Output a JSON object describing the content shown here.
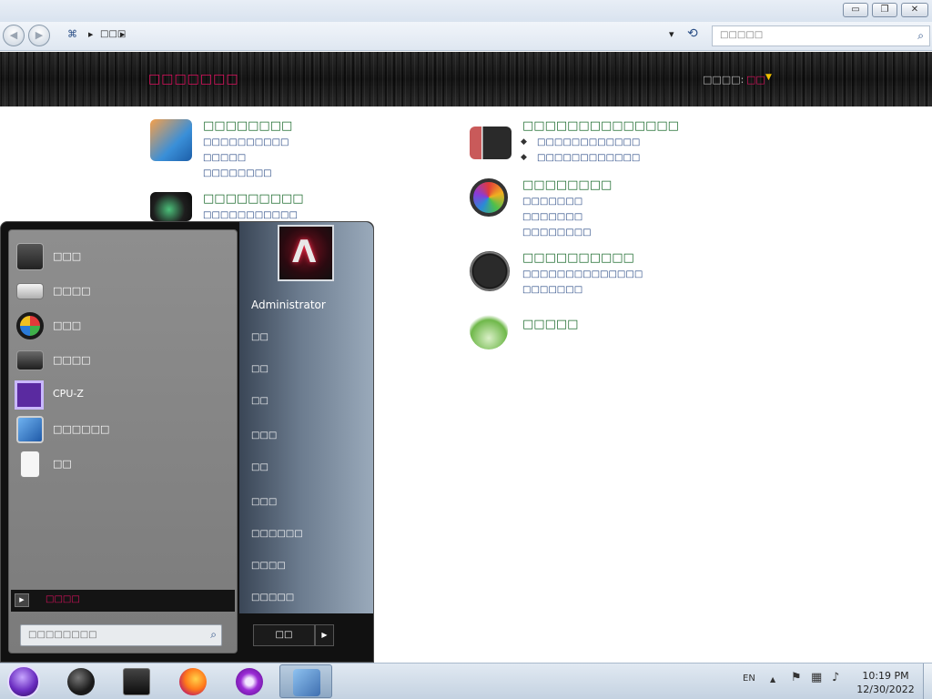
{
  "window": {
    "minimize_glyph": "▭",
    "maximize_glyph": "❐",
    "close_glyph": "✕"
  },
  "addressbar": {
    "back_glyph": "◀",
    "forward_glyph": "▶",
    "crumb_sep": "▶",
    "crumb_label": "□□□",
    "dropdown_glyph": "▾",
    "refresh_glyph": "⟲",
    "search_placeholder": "□□□□□",
    "search_icon": "search-icon"
  },
  "banner": {
    "title": "□□□□□□□",
    "view_by_label": "□□□□:",
    "view_by_value": "□□",
    "caret": "▼"
  },
  "categories": [
    {
      "title": "□□□□□□□□",
      "links": [
        "□□□□□□□□□□",
        "□□□□□",
        "□□□□□□□□"
      ]
    },
    {
      "title": "□□□□□□□□□",
      "links": [
        "□□□□□□□□□□□"
      ]
    },
    {
      "title": "□□□□□□□□□□□□□□",
      "links": [
        "□□□□□□□□□□□□",
        "□□□□□□□□□□□□"
      ]
    },
    {
      "title": "□□□□□□□□",
      "links": [
        "□□□□□□□",
        "□□□□□□□",
        "□□□□□□□□"
      ]
    },
    {
      "title": "□□□□□□□□□□",
      "links": [
        "□□□□□□□□□□□□□□",
        "□□□□□□□"
      ]
    },
    {
      "title": "□□□□□",
      "links": []
    }
  ],
  "start_menu": {
    "programs": [
      {
        "label": "□□□",
        "icon": "calculator-icon",
        "color": "#3a3a3a"
      },
      {
        "label": "□□□□",
        "icon": "keyboard-icon",
        "color": "#c9c9c9"
      },
      {
        "label": "□□□",
        "icon": "windows-logo-icon",
        "color": "#1e1e1e"
      },
      {
        "label": "□□□□",
        "icon": "camcorder-icon",
        "color": "#2d2d2d"
      },
      {
        "label": "CPU-Z",
        "icon": "cpu-z-icon",
        "color": "#5a2aa0"
      },
      {
        "label": "□□□□□□",
        "icon": "remote-desktop-icon",
        "color": "#3b7fd1"
      },
      {
        "label": "□□",
        "icon": "solitaire-icon",
        "color": "#e8e8e8"
      }
    ],
    "all_programs_label": "□□□□",
    "all_programs_arrow": "▶",
    "search_placeholder": "□□□□□□□□",
    "user_name": "Administrator",
    "right_items": [
      "□□",
      "□□",
      "□□",
      "□□□",
      "□□",
      "□□□",
      "□□□□□□",
      "□□□□",
      "□□□□□"
    ],
    "shutdown_label": "□□",
    "shutdown_arrow": "▶"
  },
  "taskbar": {
    "apps": [
      {
        "name": "media-player-icon",
        "color": "#1a1a1a"
      },
      {
        "name": "computer-icon",
        "color": "#111111"
      },
      {
        "name": "firefox-icon",
        "color": "#ff7a1a"
      },
      {
        "name": "infinity-app-icon",
        "color": "#9b2bd6"
      },
      {
        "name": "control-panel-icon",
        "color": "#3f6fb0"
      }
    ],
    "language": "EN",
    "tray_expand": "▲",
    "time": "10:19 PM",
    "date": "12/30/2022"
  }
}
